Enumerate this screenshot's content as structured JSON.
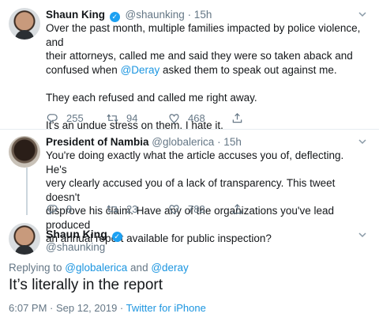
{
  "tweet1": {
    "name": "Shaun King",
    "handle": "@shaunking",
    "time": "· 15h",
    "line1": "Over the past month, multiple families impacted by police violence, and",
    "line2": "their attorneys, called me and said they were so taken aback and",
    "line3_pre": "confused when ",
    "line3_mention": "@Deray",
    "line3_post": " asked them to speak out against me.",
    "para2": "They each refused and called me right away.",
    "para3": "It’s an undue stress on them. I hate it.",
    "replies": "255",
    "retweets": "94",
    "likes": "468"
  },
  "tweet2": {
    "name": "President of Nambia",
    "handle": "@globalerica",
    "time": "· 15h",
    "line1": "You're doing exactly what the article accuses you of, deflecting. He's",
    "line2": "very clearly accused you of a lack of transparency. This tweet doesn't",
    "line3": "disprove his claim. Have any of the organizations you've lead produced",
    "line4": "an annual report available for public inspection?",
    "replies": "8",
    "retweets": "23",
    "likes": "782"
  },
  "main": {
    "name": "Shaun King",
    "handle": "@shaunking",
    "replying_label": "Replying to ",
    "replying_mention1": "@globalerica",
    "replying_and": " and ",
    "replying_mention2": "@deray",
    "text": "It’s literally in the report",
    "timestamp": "6:07 PM · Sep 12, 2019 · ",
    "source": "Twitter for iPhone"
  },
  "colors": {
    "accent": "#1b95e0",
    "muted": "#657786",
    "verified": "#1da1f2"
  },
  "icons": [
    "reply-icon",
    "retweet-icon",
    "like-icon",
    "share-icon",
    "verified-icon",
    "chevron-down-icon"
  ]
}
